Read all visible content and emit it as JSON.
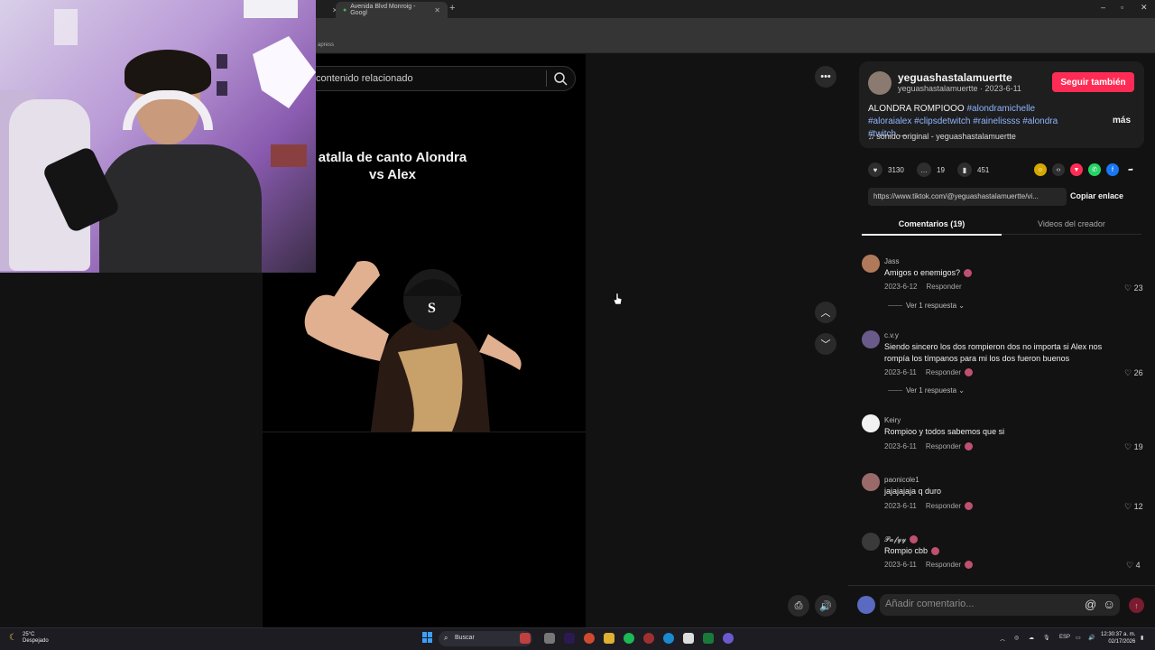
{
  "browser": {
    "tabs": [
      {
        "label": "Avenida Blvd Monroig - Googl",
        "active": false
      }
    ],
    "bookmark_fragment": "apress"
  },
  "video": {
    "search_text": "contenido relacionado",
    "title": "atalla de canto Alondra vs Alex"
  },
  "post": {
    "username": "yeguashastalamuertte",
    "subline": "yeguashastalamuertte · 2023-6-11",
    "follow_label": "Seguir también",
    "desc_text": "ALONDRA ROMPIOOO",
    "tags": [
      "#alondramichelle",
      "#aloraialex",
      "#clipsdetwitch",
      "#rainelissss",
      "#alondra",
      "#twitch"
    ],
    "desc_ellipsis": "...",
    "more_label": "más",
    "sound": "sonido original - yeguashastalamuertte",
    "likes": "3130",
    "comments_count": "19",
    "saves": "451",
    "link": "https://www.tiktok.com/@yeguashastalamuertte/vi...",
    "copy_label": "Copiar enlace",
    "tab_comments": "Comentarios (19)",
    "tab_videos": "Videos del creador"
  },
  "comments": [
    {
      "name": "Jass",
      "text": "Amigos o enemigos?",
      "date": "2023-6-12",
      "reply": "Responder",
      "likes": "23",
      "replies": "Ver 1 respuesta",
      "avatar_color": "#b07a5a"
    },
    {
      "name": "c.v.y",
      "text": "Siendo sincero los dos rompieron dos no importa si Alex nos rompía los tímpanos para mi los dos fueron buenos",
      "date": "2023-6-11",
      "reply": "Responder",
      "likes": "26",
      "replies": "Ver 1 respuesta",
      "avatar_color": "#6a5a8a"
    },
    {
      "name": "Keiry",
      "text": "Rompioo y todos sabemos que si",
      "date": "2023-6-11",
      "reply": "Responder",
      "likes": "19",
      "replies": "",
      "avatar_color": "#f2f2f2"
    },
    {
      "name": "paonicole1",
      "text": "jajajajaja q duro",
      "date": "2023-6-11",
      "reply": "Responder",
      "likes": "12",
      "replies": "",
      "avatar_color": "#9a6a6a"
    },
    {
      "name": "𝓟𝓪𝓯𝔂𝔂",
      "text": "Rompio cbb",
      "date": "2023-6-11",
      "reply": "Responder",
      "likes": "4",
      "replies": "",
      "avatar_color": "#3a3a3a"
    }
  ],
  "comment_box": {
    "placeholder": "Añadir comentario..."
  },
  "taskbar": {
    "weather_temp": "25°C",
    "weather_desc": "Despejado",
    "search_label": "Buscar",
    "lang": "ESP",
    "time": "12:30:37 a. m.",
    "date": "02/17/2026"
  },
  "colors": {
    "accent": "#fe2c55",
    "tag": "#8fb5ff"
  }
}
